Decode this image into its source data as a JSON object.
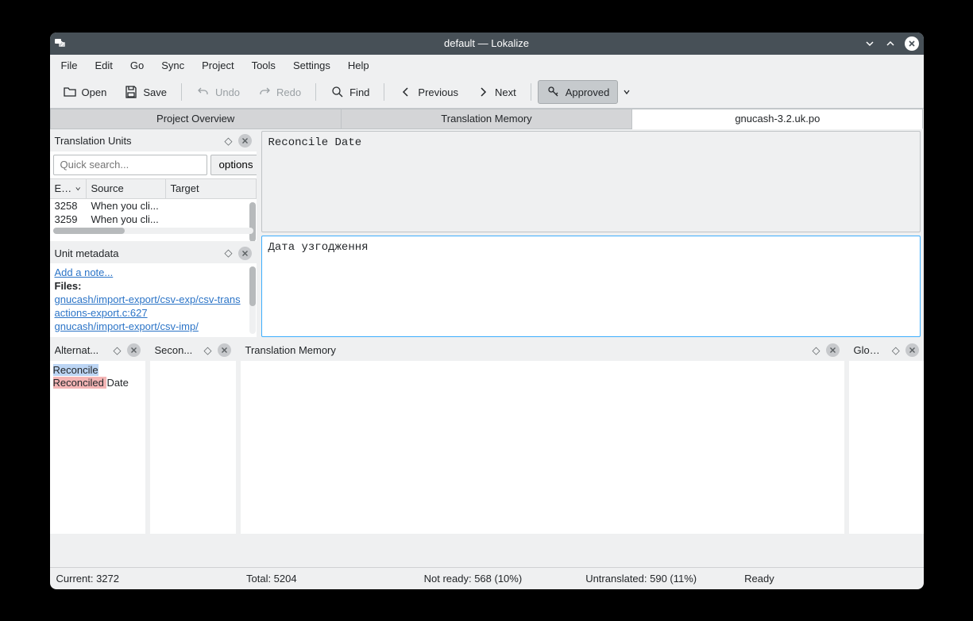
{
  "window_title": "default — Lokalize",
  "menu": [
    "File",
    "Edit",
    "Go",
    "Sync",
    "Project",
    "Tools",
    "Settings",
    "Help"
  ],
  "toolbar": {
    "open": "Open",
    "save": "Save",
    "undo": "Undo",
    "redo": "Redo",
    "find": "Find",
    "previous": "Previous",
    "next": "Next",
    "approved": "Approved"
  },
  "tabs": [
    {
      "label": "Project Overview",
      "active": false
    },
    {
      "label": "Translation Memory",
      "active": false
    },
    {
      "label": "gnucash-3.2.uk.po",
      "active": true
    }
  ],
  "tu_panel": {
    "title": "Translation Units",
    "search_placeholder": "Quick search...",
    "options": "options",
    "columns": {
      "entry": "Entry",
      "source": "Source",
      "target": "Target"
    },
    "rows": [
      {
        "entry": "3258",
        "source": "When you cli..."
      },
      {
        "entry": "3259",
        "source": "When you cli..."
      }
    ]
  },
  "um_panel": {
    "title": "Unit metadata",
    "add_note": "Add a note...",
    "files_label": "Files:",
    "links": [
      "gnucash/import-export/csv-exp/csv-transactions-export.c:627",
      "gnucash/import-export/csv-imp/"
    ]
  },
  "editor": {
    "source": "Reconcile Date",
    "target": "Дата узгодження"
  },
  "bottom_panels": {
    "alternat": "Alternat...",
    "secon": "Secon...",
    "tm": "Translation Memory",
    "glos": "Glos..."
  },
  "alternat": {
    "reconcile": "Reconcile",
    "reconciled": "Reconciled ",
    "date": "Date"
  },
  "status": {
    "current": "Current: 3272",
    "total": "Total: 5204",
    "not_ready": "Not ready: 568 (10%)",
    "untranslated": "Untranslated: 590 (11%)",
    "ready": "Ready"
  }
}
